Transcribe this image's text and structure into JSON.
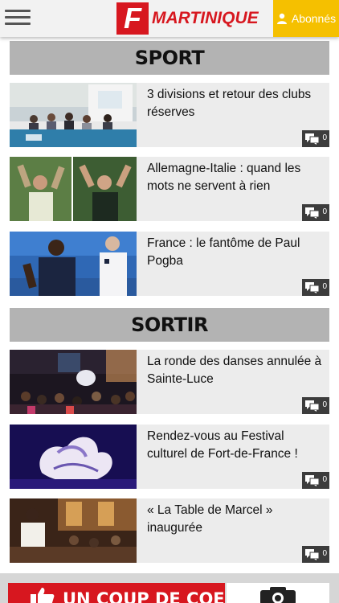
{
  "header": {
    "logo_letter": "F",
    "logo_name": "Martinique",
    "subscribers_label": "Abonnés",
    "brand_color": "#d7171f",
    "accent_color": "#f5c000"
  },
  "sections": [
    {
      "title": "SPORT",
      "articles": [
        {
          "title": "3 divisions et retour des clubs réserves",
          "comments": "0"
        },
        {
          "title": "Allemagne-Italie : quand les mots ne servent à rien",
          "comments": "0"
        },
        {
          "title": "France : le fantôme de Paul Pogba",
          "comments": "0"
        }
      ]
    },
    {
      "title": "SORTIR",
      "articles": [
        {
          "title": "La ronde des danses annulée à Sainte-Luce",
          "comments": "0"
        },
        {
          "title": "Rendez-vous au Festival culturel de Fort-de-France !",
          "comments": "0"
        },
        {
          "title": "« La Table de Marcel » inaugurée",
          "comments": "0"
        }
      ]
    }
  ],
  "banner": {
    "text": "UN COUP DE COEUR ?"
  },
  "icons": {
    "menu": "hamburger-icon",
    "user": "user-icon",
    "comments": "comments-icon",
    "thumb": "thumbs-up-icon",
    "camera": "camera-icon"
  }
}
